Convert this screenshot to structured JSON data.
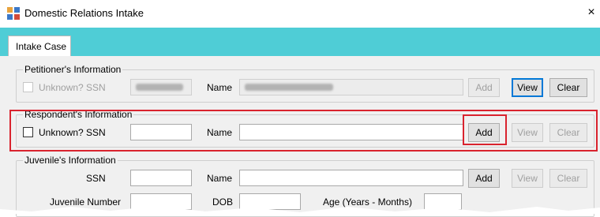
{
  "window": {
    "title": "Domestic Relations Intake",
    "close_glyph": "×"
  },
  "tabs": [
    {
      "label": "Intake Case",
      "selected": true
    }
  ],
  "petitioner": {
    "legend": "Petitioner's Information",
    "unknown_label": "Unknown?",
    "unknown_checked": false,
    "ssn_label": "SSN",
    "name_label": "Name",
    "add_label": "Add",
    "view_label": "View",
    "clear_label": "Clear"
  },
  "respondent": {
    "legend": "Respondent's Information",
    "unknown_label": "Unknown?",
    "unknown_checked": false,
    "ssn_label": "SSN",
    "ssn_value": "",
    "name_label": "Name",
    "name_value": "",
    "add_label": "Add",
    "view_label": "View",
    "clear_label": "Clear"
  },
  "juvenile": {
    "legend": "Juvenile's Information",
    "ssn_label": "SSN",
    "name_label": "Name",
    "number_label": "Juvenile Number",
    "dob_label": "DOB",
    "age_label": "Age (Years - Months)",
    "add_label": "Add",
    "view_label": "View",
    "clear_label": "Clear"
  },
  "colors": {
    "tab_strip": "#4fcdd6",
    "highlight": "#d9232e",
    "focus": "#0078d7"
  },
  "icons": {
    "app": "app-window-icon",
    "close": "close-icon"
  }
}
